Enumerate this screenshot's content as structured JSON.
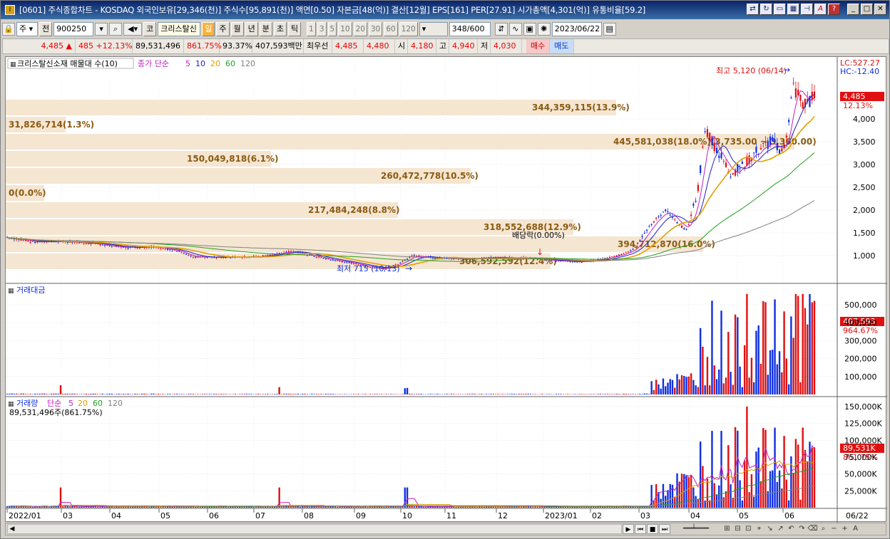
{
  "window": {
    "title": "[0601] 주식종합차트 - KOSDAQ 외국인보유[29,346(천)] 주식수[95,891(천)] 액면[0.50] 자본금[48(억)] 결산[12월] EPS[161] PER[27.91] 시가총액[4,301(억)] 유통비율[59.2]",
    "app_icon": "I"
  },
  "toolbar": {
    "market": "주",
    "prev_label": "전",
    "code": "900250",
    "sector_label": "코",
    "stock_name": "크리스탈신",
    "periods": [
      "일",
      "주",
      "월",
      "년",
      "분",
      "초",
      "틱"
    ],
    "selected_period": "일",
    "intervals": [
      "1",
      "3",
      "5",
      "10",
      "20",
      "30",
      "60",
      "120"
    ],
    "count": "348",
    "count_total": "/600",
    "date": "2023/06/22"
  },
  "quote": {
    "price": "4,485",
    "change_arrow": "▲",
    "change": "485",
    "change_pct": "+12.13%",
    "volume": "89,531,496",
    "volume_ratio": "861.75%",
    "strength": "93.37%",
    "amount": "407,593백만",
    "best_label": "최우선",
    "best_ask": "4,485",
    "best_bid": "4,480",
    "open_label": "시",
    "open": "4,180",
    "high_label": "고",
    "high": "4,940",
    "low_label": "저",
    "low": "4,030",
    "buy_label": "매수",
    "sell_label": "매도"
  },
  "price_panel": {
    "legend_title": "크리스탈신소재 매물대 수(10)",
    "ma_label": "종가 단순",
    "ma_periods": [
      "5",
      "10",
      "20",
      "60",
      "120"
    ],
    "lc_label": "LC:527.27",
    "hc_label": "HC:-12.40",
    "current_price": "4,485",
    "current_pct": "12.13%",
    "high_marker": "최고 5,120 (06/14)",
    "low_marker": "최저 715 (10/13)",
    "dividend_marker": "배당락(0.00%)",
    "y_ticks": [
      "4,000",
      "3,500",
      "3,000",
      "2,500",
      "2,000",
      "1,500",
      "1,000"
    ],
    "volume_profile": [
      {
        "label": "344,359,115(13.9%)"
      },
      {
        "label": "31,826,714(1.3%)"
      },
      {
        "label": "445,581,038(18.0%)(3,735.00 ~ 3,360.00)"
      },
      {
        "label": "150,049,818(6.1%)"
      },
      {
        "label": "260,472,778(10.5%)"
      },
      {
        "label": "0(0.0%)"
      },
      {
        "label": "217,484,248(8.8%)"
      },
      {
        "label": "318,552,688(12.9%)"
      },
      {
        "label": "394,712,870(16.0%)"
      },
      {
        "label": "306,592,592(12.4%)"
      }
    ]
  },
  "amount_panel": {
    "title": "거래대금",
    "current_value": "407,593",
    "current_pct": "964.67%",
    "y_ticks": [
      "500,000",
      "400,000",
      "300,000",
      "200,000",
      "100,000"
    ]
  },
  "volume_panel": {
    "title": "거래량",
    "ma_label": "단순",
    "ma_periods": [
      "5",
      "20",
      "60",
      "120"
    ],
    "sub_label": "89,531,496주(861.75%)",
    "current_value": "89,531K",
    "current_pct": "861.75%",
    "y_ticks": [
      "150,000K",
      "125,000K",
      "100,000K",
      "75,000K",
      "50,000K",
      "25,000K"
    ]
  },
  "x_axis": {
    "labels": [
      "2022/01",
      "03",
      "04",
      "05",
      "06",
      "07",
      "08",
      "09",
      "10",
      "11",
      "12",
      "2023/01",
      "02",
      "03",
      "04",
      "05",
      "06"
    ],
    "right_label": "06/22"
  },
  "colors": {
    "up": "#e01010",
    "down": "#1030e0",
    "ma5": "#c020c0",
    "ma10": "#2020c0",
    "ma20": "#e0a000",
    "ma60": "#20a020",
    "ma120": "#808080",
    "profile": "#f5e6d2",
    "profile_text": "#8b5a10"
  },
  "icons": {
    "save": "save-icon",
    "settings": "gear-icon",
    "calendar": "calendar-icon",
    "search": "search-icon"
  }
}
